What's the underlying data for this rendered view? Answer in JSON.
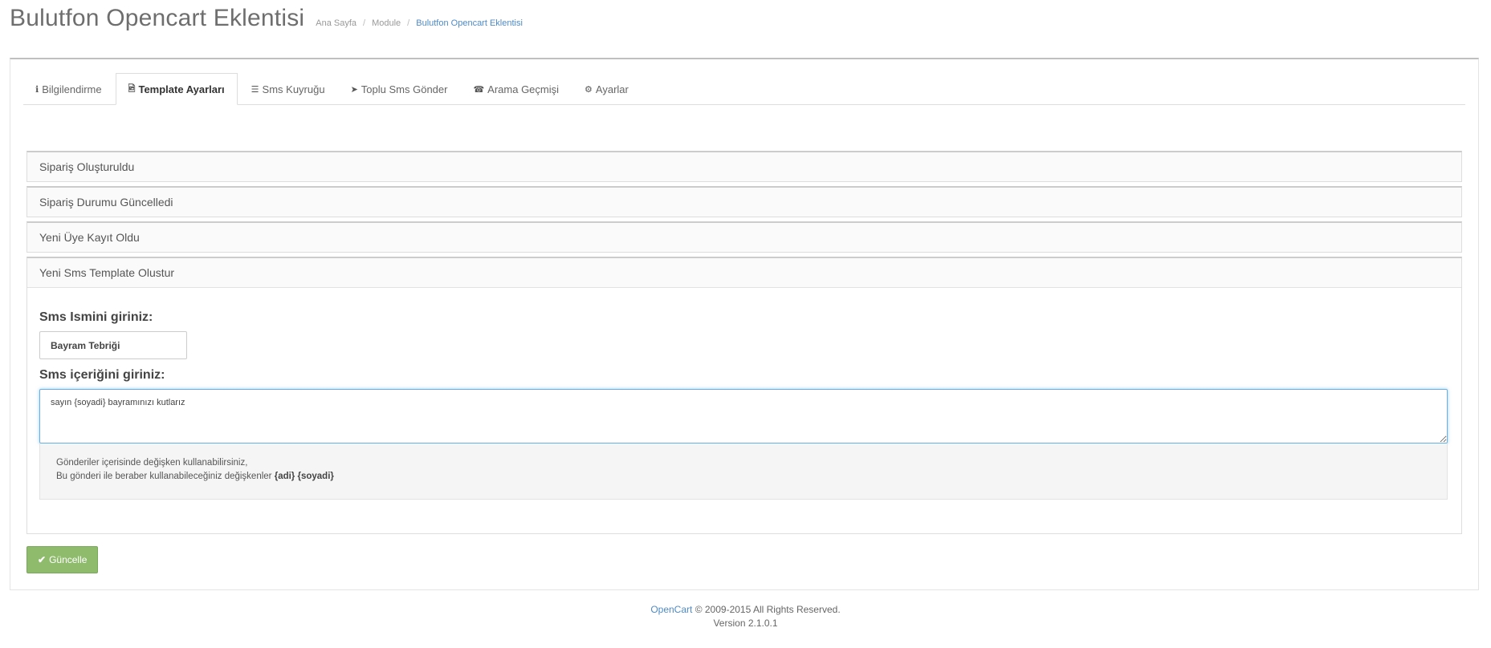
{
  "header": {
    "title": "Bulutfon Opencart Eklentisi",
    "breadcrumb": [
      "Ana Sayfa",
      "Module",
      "Bulutfon Opencart Eklentisi"
    ]
  },
  "tabs": [
    {
      "label": "Bilgilendirme",
      "icon": "info-circle-icon",
      "glyph": "ℹ"
    },
    {
      "label": "Template Ayarları",
      "icon": "file-image-icon",
      "glyph": "🖻",
      "active": true
    },
    {
      "label": "Sms Kuyruğu",
      "icon": "list-icon",
      "glyph": "☰"
    },
    {
      "label": "Toplu Sms Gönder",
      "icon": "paper-plane-icon",
      "glyph": "➤"
    },
    {
      "label": "Arama Geçmişi",
      "icon": "phone-square-icon",
      "glyph": "☎"
    },
    {
      "label": "Ayarlar",
      "icon": "gear-icon",
      "glyph": "⚙"
    }
  ],
  "accordion": {
    "items": [
      "Sipariş Oluşturuldu",
      "Sipariş Durumu Güncelledi",
      "Yeni Üye Kayıt Oldu",
      "Yeni Sms Template Olustur"
    ]
  },
  "form": {
    "name_label": "Sms Ismini giriniz:",
    "name_value": "Bayram Tebriği",
    "content_label": "Sms içeriğini giriniz:",
    "content_value": "sayın {soyadi} bayramınızı kutlarız",
    "info_line1": "Gönderiler içerisinde değişken kullanabilirsiniz,",
    "info_line2": "Bu gönderi ile beraber kullanabileceğiniz değişkenler",
    "info_vars": "{adi} {soyadi}"
  },
  "buttons": {
    "update_label": "Güncelle",
    "update_icon": "check-icon",
    "update_color": "#8fbb6c"
  },
  "footer": {
    "brand": "OpenCart",
    "copyright": "© 2009-2015 All Rights Reserved.",
    "version": "Version 2.1.0.1"
  },
  "colors": {
    "accent": "#4f8ac6",
    "focus": "#66afe9"
  }
}
